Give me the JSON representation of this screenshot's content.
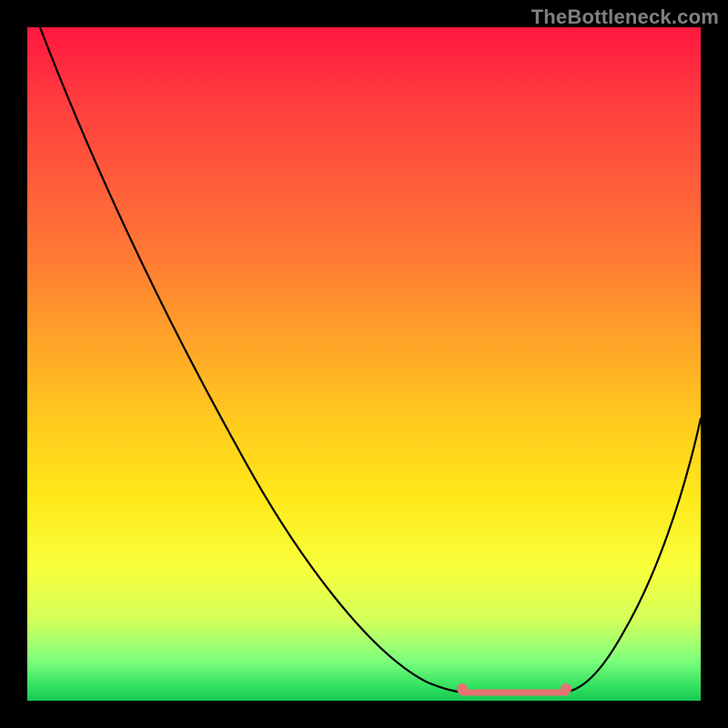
{
  "watermark": {
    "text": "TheBottleneck.com"
  },
  "chart_data": {
    "type": "line",
    "title": "",
    "xlabel": "",
    "ylabel": "",
    "xlim": [
      0,
      100
    ],
    "ylim": [
      0,
      100
    ],
    "grid": false,
    "legend": false,
    "series": [
      {
        "name": "bottleneck-curve",
        "x": [
          0,
          8,
          16,
          24,
          32,
          40,
          48,
          56,
          60,
          64,
          68,
          72,
          76,
          80,
          84,
          88,
          92,
          96,
          100
        ],
        "values": [
          100,
          89,
          77,
          65,
          53,
          41,
          29,
          17,
          12,
          7,
          3,
          1,
          1,
          3,
          8,
          16,
          26,
          38,
          50
        ],
        "note": "Percent bottleneck vs. normalized component-performance axis; 0 = perfect balance. Values read from curve height against the gradient, green≈0 red≈100."
      }
    ],
    "plateau": {
      "name": "optimal-range-marker",
      "x_start": 64,
      "x_end": 80,
      "value": 1
    },
    "gradient_stops": [
      {
        "pct": 0,
        "color": "#ff173f"
      },
      {
        "pct": 46,
        "color": "#ffa229"
      },
      {
        "pct": 80,
        "color": "#f8ff3a"
      },
      {
        "pct": 100,
        "color": "#18c850"
      }
    ]
  }
}
